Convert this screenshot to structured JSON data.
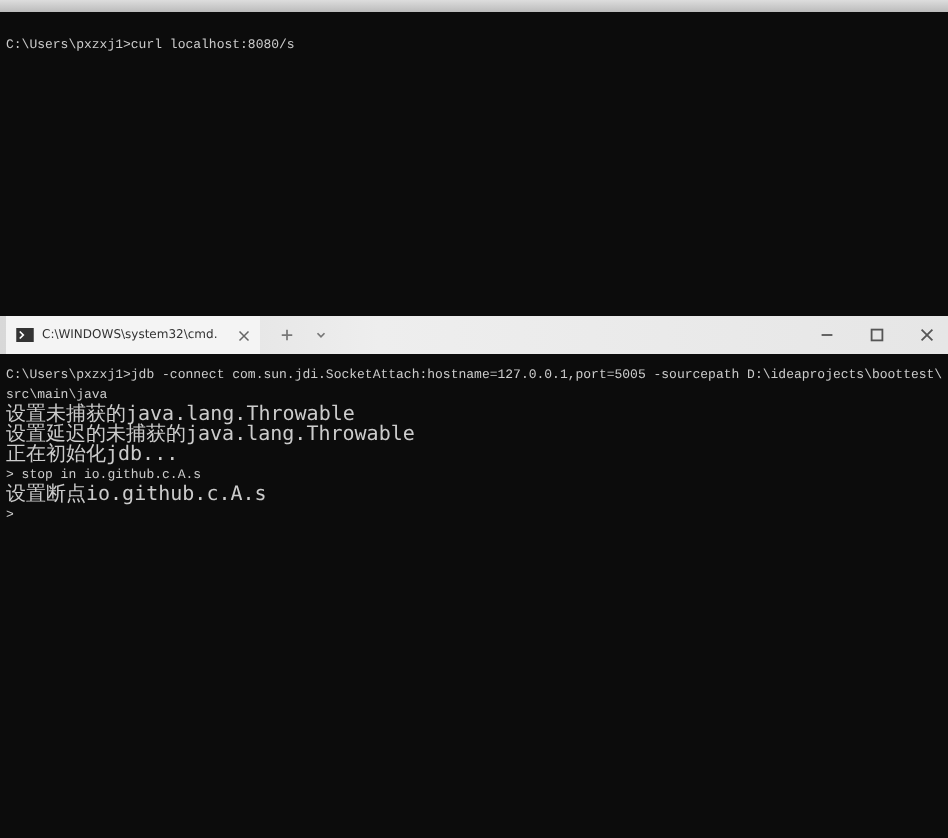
{
  "top_window": {
    "lines": [
      {
        "kind": "prompt",
        "text": "C:\\Users\\pxzxj1>curl localhost:8080/s"
      }
    ]
  },
  "bottom_window": {
    "tab": {
      "title": "C:\\WINDOWS\\system32\\cmd.",
      "selected": true
    },
    "lines": [
      {
        "kind": "prompt",
        "text": "C:\\Users\\pxzxj1>jdb -connect com.sun.jdi.SocketAttach:hostname=127.0.0.1,port=5005 -sourcepath D:\\ideaprojects\\boottest\\"
      },
      {
        "kind": "prompt",
        "text": "src\\main\\java"
      },
      {
        "kind": "output",
        "text": "设置未捕获的java.lang.Throwable"
      },
      {
        "kind": "output",
        "text": "设置延迟的未捕获的java.lang.Throwable"
      },
      {
        "kind": "output",
        "text": "正在初始化jdb..."
      },
      {
        "kind": "prompt",
        "text": "> stop in io.github.c.A.s"
      },
      {
        "kind": "output",
        "text": "设置断点io.github.c.A.s"
      },
      {
        "kind": "prompt",
        "text": ">"
      }
    ]
  }
}
